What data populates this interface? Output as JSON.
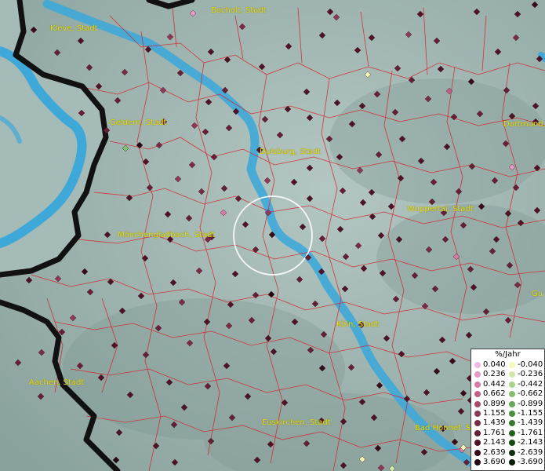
{
  "cities": [
    {
      "name": "Bocholt, Stadt"
    },
    {
      "name": "Kleve, Stadt"
    },
    {
      "name": "Geldern, Stadt"
    },
    {
      "name": "Duisburg, Stadt"
    },
    {
      "name": "Dortmund, S"
    },
    {
      "name": "Wuppertal, Stadt"
    },
    {
      "name": "Mönchengladbach, Stadt"
    },
    {
      "name": "Köln, Stadt"
    },
    {
      "name": "Aachen, Stadt"
    },
    {
      "name": "Euskirchen, Stadt"
    },
    {
      "name": "Bad Honnef, S"
    },
    {
      "name": "Gu"
    }
  ],
  "legend": {
    "title": "%/Jahr",
    "positive": [
      {
        "label": "0.040",
        "color": "#f4b8e0"
      },
      {
        "label": "0.236",
        "color": "#e699c4"
      },
      {
        "label": "0.442",
        "color": "#d97aa6"
      },
      {
        "label": "0.662",
        "color": "#c45e88"
      },
      {
        "label": "0.899",
        "color": "#a94a6c"
      },
      {
        "label": "1.155",
        "color": "#8e3a57"
      },
      {
        "label": "1.439",
        "color": "#7a2c44"
      },
      {
        "label": "1.761",
        "color": "#652035"
      },
      {
        "label": "2.143",
        "color": "#4e1426"
      },
      {
        "label": "2.639",
        "color": "#380b18"
      },
      {
        "label": "3.690",
        "color": "#22040c"
      }
    ],
    "negative": [
      {
        "label": "-0.040",
        "color": "#f4f8b8"
      },
      {
        "label": "-0.236",
        "color": "#cfe8a6"
      },
      {
        "label": "-0.442",
        "color": "#a8d48e"
      },
      {
        "label": "-0.662",
        "color": "#86bf72"
      },
      {
        "label": "-0.899",
        "color": "#66a858"
      },
      {
        "label": "-1.155",
        "color": "#4b9040"
      },
      {
        "label": "-1.439",
        "color": "#36782d"
      },
      {
        "label": "-1.761",
        "color": "#25601e"
      },
      {
        "label": "-2.143",
        "color": "#174812"
      },
      {
        "label": "-2.639",
        "color": "#0c3209"
      },
      {
        "label": "-3.690",
        "color": "#041c03"
      }
    ]
  },
  "colors": {
    "land": "#9fb4b0",
    "water": "#3ea8d8",
    "district_border": "#d81e2a",
    "country_border": "#111111",
    "city_label": "#e8e000",
    "highlight_ring": "#ffffff"
  }
}
